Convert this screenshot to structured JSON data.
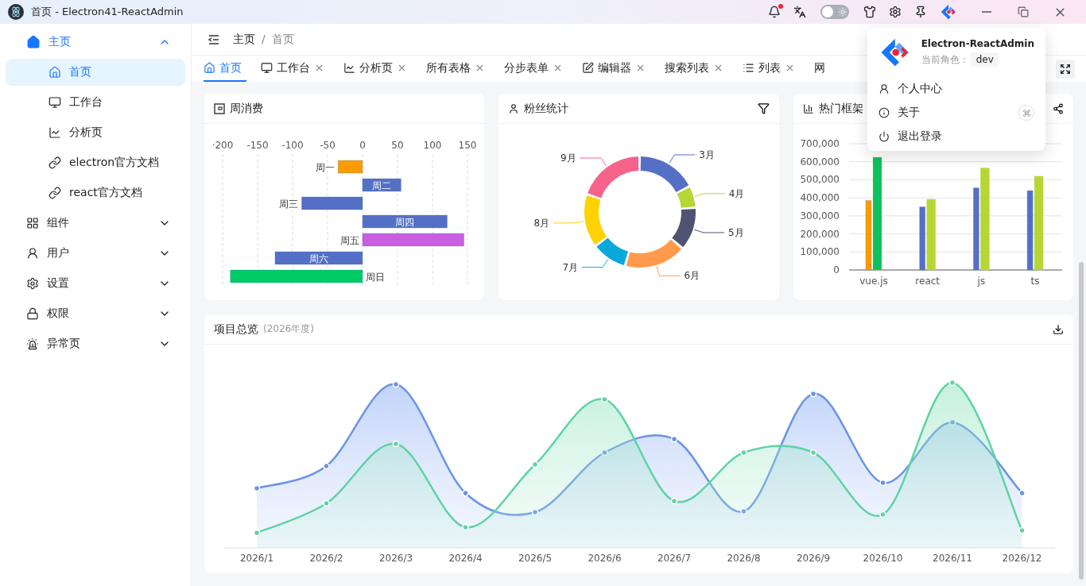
{
  "window": {
    "title": "首页 - Electron41-ReactAdmin"
  },
  "titlebar": {
    "notification_dot": true,
    "theme_toggle": {
      "on": false
    }
  },
  "sidebar": {
    "items": [
      {
        "label": "主页",
        "expanded": true,
        "children": [
          {
            "label": "首页",
            "selected": true
          },
          {
            "label": "工作台",
            "selected": false
          },
          {
            "label": "分析页",
            "selected": false
          },
          {
            "label": "electron官方文档",
            "selected": false
          },
          {
            "label": "react官方文档",
            "selected": false
          }
        ]
      },
      {
        "label": "组件",
        "expanded": false
      },
      {
        "label": "用户",
        "expanded": false
      },
      {
        "label": "设置",
        "expanded": false
      },
      {
        "label": "权限",
        "expanded": false
      },
      {
        "label": "异常页",
        "expanded": false
      }
    ]
  },
  "breadcrumb": {
    "items": [
      "主页",
      "首页"
    ],
    "separator": "/"
  },
  "tabs": [
    {
      "label": "首页",
      "selected": true,
      "closable": false
    },
    {
      "label": "工作台",
      "selected": false,
      "closable": true
    },
    {
      "label": "分析页",
      "selected": false,
      "closable": true
    },
    {
      "label": "所有表格",
      "selected": false,
      "closable": true
    },
    {
      "label": "分步表单",
      "selected": false,
      "closable": true
    },
    {
      "label": "编辑器",
      "selected": false,
      "closable": true
    },
    {
      "label": "搜索列表",
      "selected": false,
      "closable": true
    },
    {
      "label": "列表",
      "selected": false,
      "closable": true
    },
    {
      "label": "网",
      "selected": false,
      "closable": false
    }
  ],
  "user_menu": {
    "app_name": "Electron-ReactAdmin",
    "role_label": "当前角色：",
    "role": "dev",
    "items": [
      {
        "label": "个人中心",
        "shortcut": false
      },
      {
        "label": "关于",
        "shortcut": true
      },
      {
        "label": "退出登录",
        "shortcut": false
      }
    ]
  },
  "weekly": {
    "title": "周消费",
    "chart_data": {
      "type": "bar",
      "orientation": "horizontal",
      "grid": true,
      "categories": [
        "周一",
        "周二",
        "周三",
        "周四",
        "周五",
        "周六",
        "周日"
      ],
      "xlim": [
        -200,
        150
      ],
      "xticks": [
        {
          "value": -200,
          "label": "·200"
        },
        -150,
        -100,
        -50,
        0,
        50,
        100,
        150
      ],
      "series": [
        {
          "color": "#5470c6",
          "values": [
            -35,
            55,
            -87,
            121,
            145,
            -125,
            -189
          ],
          "colors": [
            "#fa9c00",
            "#5470c6",
            "#5470c6",
            "#5470c6",
            "#c95ee0",
            "#5470c6",
            "#00cc66"
          ]
        }
      ]
    }
  },
  "fans": {
    "title": "粉丝统计",
    "slices": [
      {
        "label": "3月",
        "color": "#5470c6"
      },
      {
        "label": "4月",
        "color": "#b6d634"
      },
      {
        "label": "5月",
        "color": "#505372"
      },
      {
        "label": "6月",
        "color": "#ff9a4d"
      },
      {
        "label": "7月",
        "color": "#0aa9dc"
      },
      {
        "label": "8月",
        "color": "#ffd100"
      },
      {
        "label": "9月",
        "color": "#f7628b"
      }
    ]
  },
  "frameworks": {
    "title": "热门框架",
    "chart_data": {
      "type": "bar",
      "grid": true,
      "categories": [
        "vue.js",
        "react",
        "js",
        "ts"
      ],
      "ylim": [
        0,
        700000
      ],
      "yticks": [
        {
          "value": 0,
          "label": "0"
        },
        {
          "value": 100000,
          "label": "100,000"
        },
        {
          "value": 200000,
          "label": "200,000"
        },
        {
          "value": 300000,
          "label": "300,000"
        },
        {
          "value": 400000,
          "label": "400,000"
        },
        {
          "value": 500000,
          "label": "500,000"
        },
        {
          "value": 600000,
          "label": "600,000"
        },
        {
          "value": 700000,
          "label": "700,000"
        }
      ],
      "series": [
        {
          "color": "#5470c6",
          "values": [
            385000,
            350000,
            455000,
            440000
          ],
          "colors": [
            "#fa9c00",
            "#5470c6",
            "#5470c6",
            "#5470c6"
          ]
        },
        {
          "color": "#b6d634",
          "values": [
            625000,
            392000,
            565000,
            520000
          ],
          "colors": [
            "#0cc25e",
            "#b6d634",
            "#b6d634",
            "#b6d634"
          ]
        }
      ]
    }
  },
  "overview": {
    "title": "项目总览",
    "subtitle": "(2026年度)",
    "x_labels": [
      "2026/1",
      "2026/2",
      "2026/3",
      "2026/4",
      "2026/5",
      "2026/6",
      "2026/7",
      "2026/8",
      "2026/9",
      "2026/10",
      "2026/11",
      "2026/12"
    ]
  }
}
